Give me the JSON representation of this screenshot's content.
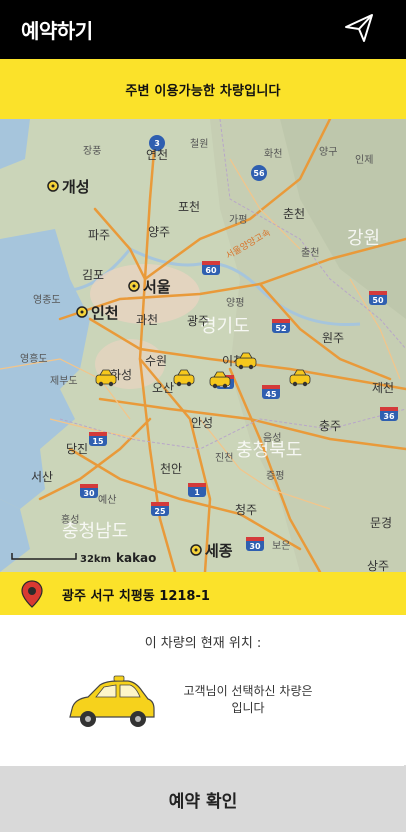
{
  "header": {
    "title": "예약하기",
    "send_icon": "send-arrow-icon"
  },
  "banner": {
    "text": "주변 이용가능한 차량입니다"
  },
  "map": {
    "provider": "kakao",
    "scale": "32km",
    "cities_major": [
      {
        "name": "개성"
      },
      {
        "name": "서울"
      },
      {
        "name": "인천"
      },
      {
        "name": "세종"
      }
    ],
    "cities": [
      {
        "name": "연천"
      },
      {
        "name": "철원"
      },
      {
        "name": "화천"
      },
      {
        "name": "양구"
      },
      {
        "name": "인제"
      },
      {
        "name": "포천"
      },
      {
        "name": "가평"
      },
      {
        "name": "춘천"
      },
      {
        "name": "파주"
      },
      {
        "name": "양주"
      },
      {
        "name": "김포"
      },
      {
        "name": "과천"
      },
      {
        "name": "광주"
      },
      {
        "name": "양평"
      },
      {
        "name": "원주"
      },
      {
        "name": "수원"
      },
      {
        "name": "오산"
      },
      {
        "name": "이천"
      },
      {
        "name": "제천"
      },
      {
        "name": "당진"
      },
      {
        "name": "안성"
      },
      {
        "name": "충주"
      },
      {
        "name": "음성"
      },
      {
        "name": "진천"
      },
      {
        "name": "증평"
      },
      {
        "name": "서산"
      },
      {
        "name": "천안"
      },
      {
        "name": "청주"
      },
      {
        "name": "문경"
      },
      {
        "name": "홍성"
      },
      {
        "name": "예산"
      },
      {
        "name": "보은"
      },
      {
        "name": "상주"
      },
      {
        "name": "장풍"
      },
      {
        "name": "영종도"
      },
      {
        "name": "영흥도"
      },
      {
        "name": "제부도"
      },
      {
        "name": "출천"
      },
      {
        "name": "화성"
      }
    ],
    "provinces": [
      {
        "name": "강원"
      },
      {
        "name": "경기도"
      },
      {
        "name": "충청북도"
      },
      {
        "name": "충청남도"
      }
    ],
    "highway_label": "서울양양고속",
    "route_shields": [
      "3",
      "56",
      "60",
      "52",
      "50",
      "35",
      "45",
      "15",
      "30",
      "1",
      "25",
      "30",
      "36"
    ],
    "car_markers": [
      "taxi-icon",
      "taxi-icon",
      "taxi-icon",
      "taxi-icon",
      "taxi-icon"
    ]
  },
  "address": {
    "text": "광주 서구 치평동 1218-1",
    "pin_icon": "location-pin-icon"
  },
  "vehicle": {
    "location_label": "이 차량의 현재 위치 :",
    "description_line1": "고객님이 선택하신 차량은",
    "description_line2": "입니다",
    "car_icon": "car-icon"
  },
  "confirm": {
    "label": "예약 확인"
  },
  "colors": {
    "header": "#000000",
    "accent": "#fbe22a",
    "button": "#d9d9d9"
  }
}
